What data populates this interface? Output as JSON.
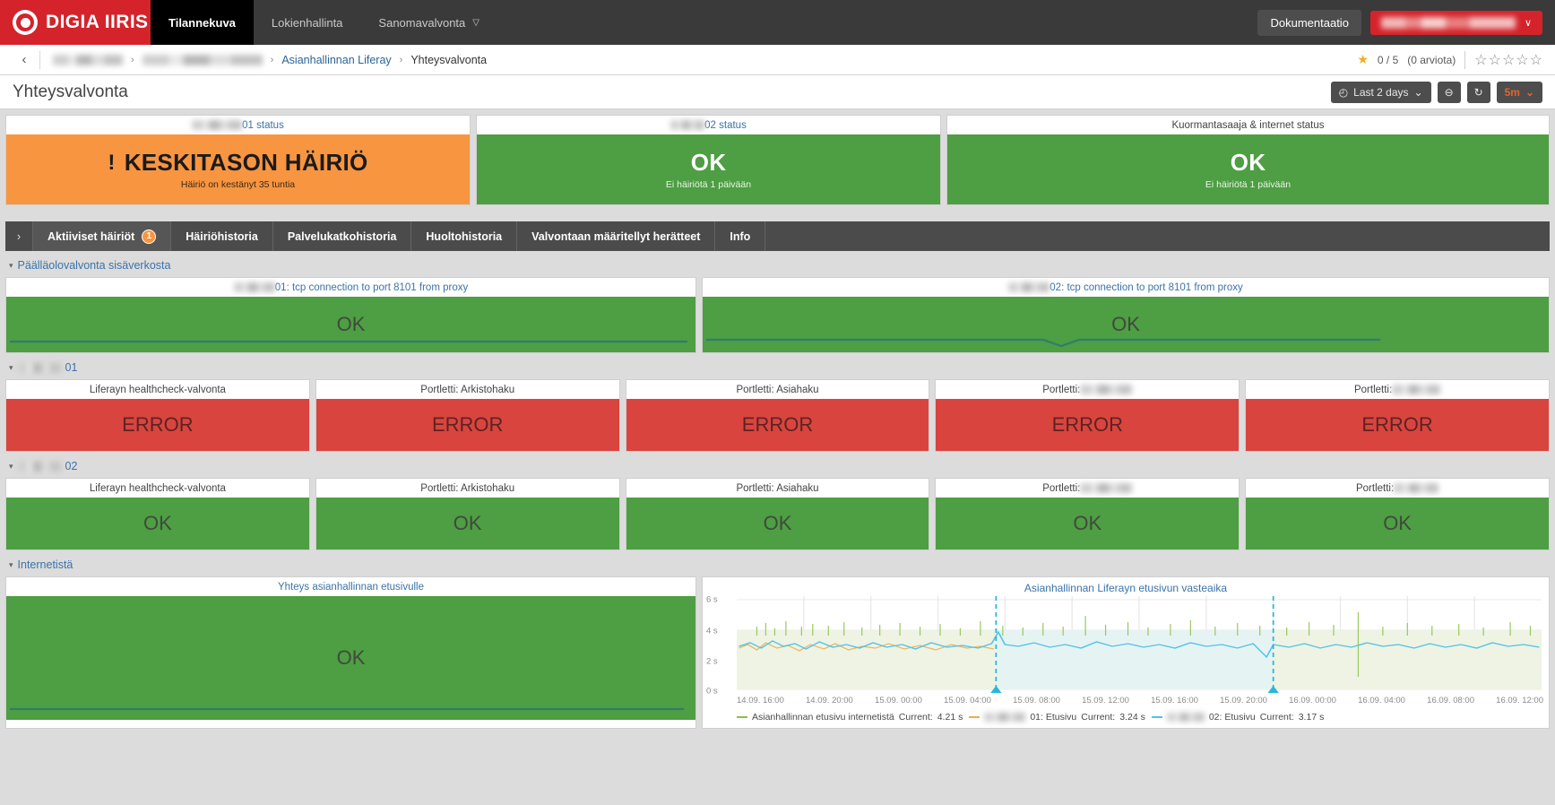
{
  "topnav": {
    "brand": "DIGIA IIRIS",
    "items": [
      {
        "label": "Tilannekuva",
        "active": true,
        "caret": false
      },
      {
        "label": "Lokienhallinta",
        "active": false,
        "caret": false
      },
      {
        "label": "Sanomavalvonta",
        "active": false,
        "caret": true
      }
    ],
    "doc_label": "Dokumentaatio",
    "user_label": "",
    "user_caret": "∨"
  },
  "breadcrumb": {
    "back": "‹",
    "items": [
      "",
      "",
      "Asianhallinnan Liferay",
      "Yhteysvalvonta"
    ],
    "separator": "›"
  },
  "rating": {
    "score": "0 / 5",
    "count": "(0 arviota)",
    "star": "★",
    "empty_star": "☆"
  },
  "page": {
    "title": "Yhteysvalvonta"
  },
  "toolbar": {
    "time_range": "Last 2 days",
    "clock_icon": "◴",
    "caret": "⌄",
    "zoom_out_icon": "⊖",
    "refresh_icon": "↻",
    "refresh_interval": "5m"
  },
  "status_panels": [
    {
      "title_prefix": "",
      "title_suffix": "01 status",
      "state": "warn",
      "main": "KESKITASON HÄIRIÖ",
      "sub": "Häiriö on kestänyt 35 tuntia",
      "bang": "!"
    },
    {
      "title_prefix": "",
      "title_suffix": "02 status",
      "state": "ok",
      "main": "OK",
      "sub": "Ei häiriötä 1 päivään",
      "bang": ""
    },
    {
      "title_prefix": null,
      "title_suffix": "Kuormantasaaja & internet status",
      "state": "ok",
      "main": "OK",
      "sub": "Ei häiriötä 1 päivään",
      "bang": ""
    }
  ],
  "tabs": {
    "toggle_icon": "›",
    "items": [
      {
        "label": "Aktiiviset häiriöt",
        "badge": "1",
        "active": true
      },
      {
        "label": "Häiriöhistoria",
        "badge": null,
        "active": false
      },
      {
        "label": "Palvelukatkohistoria",
        "badge": null,
        "active": false
      },
      {
        "label": "Huoltohistoria",
        "badge": null,
        "active": false
      },
      {
        "label": "Valvontaan määritellyt herätteet",
        "badge": null,
        "active": false
      },
      {
        "label": "Info",
        "badge": null,
        "active": false
      }
    ]
  },
  "sections": [
    {
      "label": "Päälläolovalvonta sisäverkosta",
      "cards": [
        {
          "title_prefix": "",
          "title": "01: tcp connection to port 8101 from proxy",
          "state": "ok",
          "value": "OK",
          "spark": true
        },
        {
          "title_prefix": "",
          "title": "02: tcp connection to port 8101 from proxy",
          "state": "ok",
          "value": "OK",
          "spark": true
        }
      ]
    },
    {
      "label_blur": true,
      "label": "01",
      "cards": [
        {
          "title": "Liferayn healthcheck-valvonta",
          "state": "err",
          "value": "ERROR"
        },
        {
          "title": "Portletti: Arkistohaku",
          "state": "err",
          "value": "ERROR"
        },
        {
          "title": "Portletti: Asiahaku",
          "state": "err",
          "value": "ERROR"
        },
        {
          "title": "Portletti: ",
          "title_blur": true,
          "state": "err",
          "value": "ERROR"
        },
        {
          "title": "Portletti: ",
          "title_blur": true,
          "state": "err",
          "value": "ERROR"
        }
      ]
    },
    {
      "label_blur": true,
      "label": "02",
      "cards": [
        {
          "title": "Liferayn healthcheck-valvonta",
          "state": "ok",
          "value": "OK"
        },
        {
          "title": "Portletti: Arkistohaku",
          "state": "ok",
          "value": "OK"
        },
        {
          "title": "Portletti: Asiahaku",
          "state": "ok",
          "value": "OK"
        },
        {
          "title": "Portletti: ",
          "title_blur": true,
          "state": "ok",
          "value": "OK"
        },
        {
          "title": "Portletti: ",
          "title_blur": true,
          "state": "ok",
          "value": "OK"
        }
      ]
    },
    {
      "label": "Internetistä",
      "cards": [
        {
          "title": "Yhteys asianhallinnan etusivulle",
          "state": "ok",
          "value": "OK",
          "spark": true
        }
      ]
    }
  ],
  "chart_data": {
    "type": "line",
    "title": "Asianhallinnan Liferayn etusivun vasteaika",
    "xlabel": "",
    "ylabel": "",
    "ylim": [
      0,
      6
    ],
    "yticks": [
      "0 s",
      "2 s",
      "4 s",
      "6 s"
    ],
    "xticks": [
      "14.09. 16:00",
      "14.09. 20:00",
      "15.09. 00:00",
      "15.09. 04:00",
      "15.09. 08:00",
      "15.09. 12:00",
      "15.09. 16:00",
      "15.09. 20:00",
      "16.09. 00:00",
      "16.09. 04:00",
      "16.09. 08:00",
      "16.09. 12:00"
    ],
    "grid": true,
    "legend_position": "bottom",
    "series": [
      {
        "name": "Asianhallinnan etusivu internetistä",
        "current_label": "Current:",
        "current": "4.21 s",
        "color": "#8bc34a",
        "values": [
          4.3,
          4.25,
          4.4,
          4.2,
          4.35,
          4.3,
          4.45,
          4.2,
          4.3,
          4.4,
          4.25,
          4.35,
          4.3,
          4.5,
          4.2,
          4.3,
          4.4,
          4.3,
          4.2,
          4.35,
          4.21
        ]
      },
      {
        "name": "01: Etusivu",
        "name_blur": true,
        "current_label": "Current:",
        "current": "3.24 s",
        "color": "#4fc3e8",
        "values": [
          3.3,
          3.2,
          3.4,
          3.25,
          3.35,
          3.2,
          3.3,
          3.45,
          3.2,
          3.3,
          3.25,
          3.4,
          3.3,
          3.2,
          3.35,
          3.3,
          3.25,
          3.4,
          3.2,
          3.3,
          3.24
        ]
      },
      {
        "name": "02: Etusivu",
        "name_blur": true,
        "current_label": "Current:",
        "current": "3.17 s",
        "color": "#f0ad4e",
        "values": [
          3.2,
          3.15,
          3.3,
          3.1,
          3.25,
          3.2,
          3.1,
          3.3,
          3.15,
          3.2,
          3.25,
          3.1,
          3.2,
          3.3,
          3.15,
          3.2,
          3.1,
          3.25,
          3.2,
          3.15,
          3.17
        ]
      }
    ],
    "annotations": [
      {
        "type": "vline",
        "x": "15.09. 03:00",
        "color": "#29b6d8",
        "style": "dashed"
      },
      {
        "type": "vline",
        "x": "15.09. 19:00",
        "color": "#29b6d8",
        "style": "dashed"
      }
    ]
  },
  "colors": {
    "brand_red": "#d4232b",
    "ok_green": "#4e9e43",
    "warn_orange": "#f89541",
    "error_red": "#d9443f",
    "accent_orange": "#e8622a",
    "link_blue": "#3b73a8"
  }
}
